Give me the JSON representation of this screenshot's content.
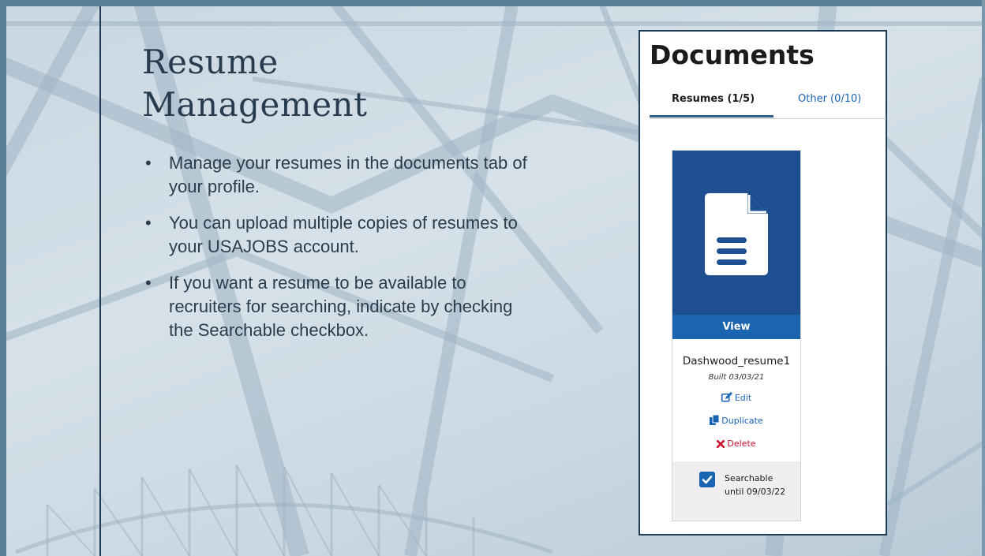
{
  "slide": {
    "title_line1": "Resume",
    "title_line2": "Management",
    "bullets": [
      "Manage your resumes in the documents tab of your profile.",
      "You can upload multiple copies of resumes to your USAJOBS account.",
      "If you want a resume to be available to recruiters for searching, indicate by checking the Searchable checkbox."
    ]
  },
  "documents": {
    "title": "Documents",
    "tabs": {
      "resumes": "Resumes (1/5)",
      "other": "Other (0/10)"
    },
    "resume_card": {
      "thumbnail_icon": "document-icon",
      "view_label": "View",
      "file_name": "Dashwood_resume1",
      "built": "Built 03/03/21",
      "edit_label": "Edit",
      "duplicate_label": "Duplicate",
      "delete_label": "Delete",
      "searchable_checked": true,
      "searchable_line1": "Searchable",
      "searchable_line2": "until 09/03/22"
    }
  },
  "colors": {
    "usajobs_blue": "#1d4f91",
    "view_button": "#1b64b0",
    "link": "#1a62b4",
    "delete": "#c8102e",
    "panel_border": "#1e3b56"
  }
}
